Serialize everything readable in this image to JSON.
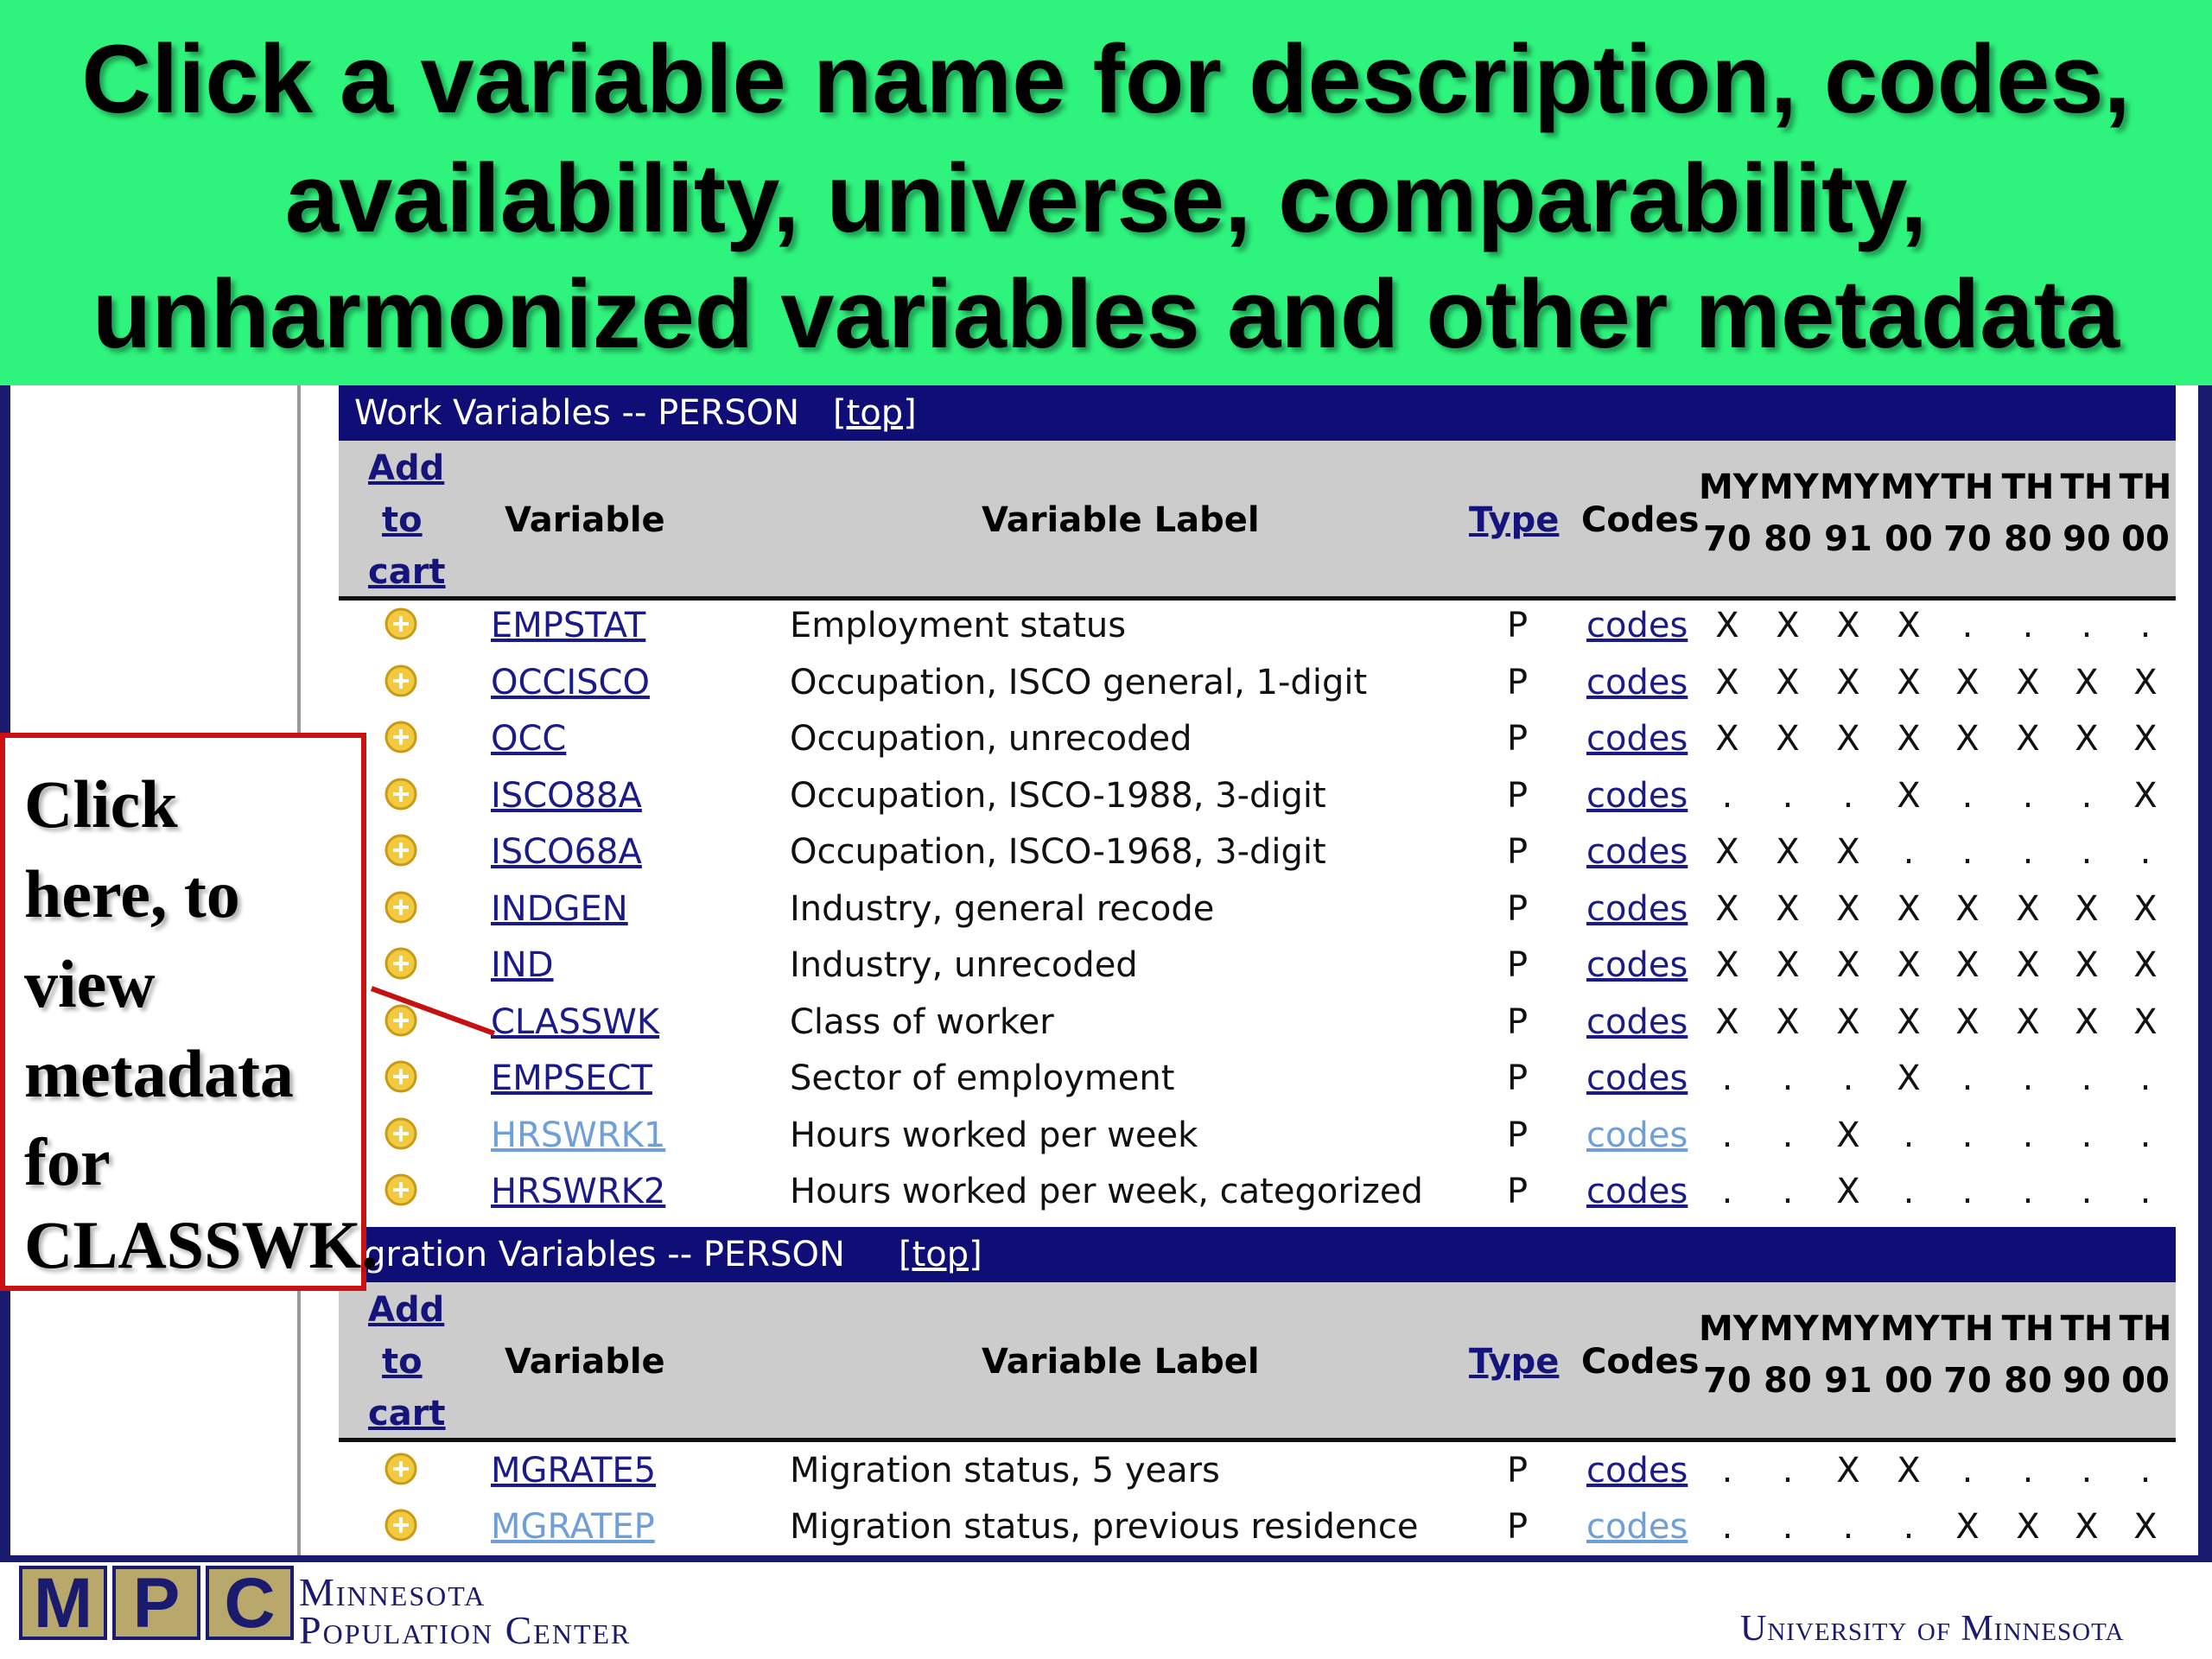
{
  "banner": {
    "lines": [
      "Click a variable name for description, codes,",
      "availability, universe, comparability,",
      "unharmonized variables and other metadata"
    ]
  },
  "columns": {
    "add_lines": [
      "Add",
      "to",
      "cart"
    ],
    "variable": "Variable",
    "label": "Variable Label",
    "type": "Type",
    "codes": "Codes",
    "sample_top": [
      "MY",
      "MY",
      "MY",
      "MY",
      "TH",
      "TH",
      "TH",
      "TH"
    ],
    "sample_bottom": [
      "70",
      "80",
      "91",
      "00",
      "70",
      "80",
      "90",
      "00"
    ]
  },
  "sections": [
    {
      "title": "Work Variables -- PERSON",
      "top_link": "[top]",
      "rows": [
        {
          "name": "EMPSTAT",
          "label": "Employment status",
          "type": "P",
          "codes": "codes",
          "marks": [
            "X",
            "X",
            "X",
            "X",
            ".",
            ".",
            ".",
            "."
          ]
        },
        {
          "name": "OCCISCO",
          "label": "Occupation, ISCO general, 1-digit",
          "type": "P",
          "codes": "codes",
          "marks": [
            "X",
            "X",
            "X",
            "X",
            "X",
            "X",
            "X",
            "X"
          ]
        },
        {
          "name": "OCC",
          "label": "Occupation, unrecoded",
          "type": "P",
          "codes": "codes",
          "marks": [
            "X",
            "X",
            "X",
            "X",
            "X",
            "X",
            "X",
            "X"
          ]
        },
        {
          "name": "ISCO88A",
          "label": "Occupation, ISCO-1988, 3-digit",
          "type": "P",
          "codes": "codes",
          "marks": [
            ".",
            ".",
            ".",
            "X",
            ".",
            ".",
            ".",
            "X"
          ]
        },
        {
          "name": "ISCO68A",
          "label": "Occupation, ISCO-1968, 3-digit",
          "type": "P",
          "codes": "codes",
          "marks": [
            "X",
            "X",
            "X",
            ".",
            ".",
            ".",
            ".",
            "."
          ]
        },
        {
          "name": "INDGEN",
          "label": "Industry, general recode",
          "type": "P",
          "codes": "codes",
          "marks": [
            "X",
            "X",
            "X",
            "X",
            "X",
            "X",
            "X",
            "X"
          ]
        },
        {
          "name": "IND",
          "label": "Industry, unrecoded",
          "type": "P",
          "codes": "codes",
          "marks": [
            "X",
            "X",
            "X",
            "X",
            "X",
            "X",
            "X",
            "X"
          ]
        },
        {
          "name": "CLASSWK",
          "label": "Class of worker",
          "type": "P",
          "codes": "codes",
          "marks": [
            "X",
            "X",
            "X",
            "X",
            "X",
            "X",
            "X",
            "X"
          ]
        },
        {
          "name": "EMPSECT",
          "label": "Sector of employment",
          "type": "P",
          "codes": "codes",
          "marks": [
            ".",
            ".",
            ".",
            "X",
            ".",
            ".",
            ".",
            "."
          ]
        },
        {
          "name": "HRSWRK1",
          "label": "Hours worked per week",
          "type": "P",
          "codes": "codes",
          "marks": [
            ".",
            ".",
            "X",
            ".",
            ".",
            ".",
            ".",
            "."
          ],
          "visited": true
        },
        {
          "name": "HRSWRK2",
          "label": "Hours worked per week, categorized",
          "type": "P",
          "codes": "codes",
          "marks": [
            ".",
            ".",
            "X",
            ".",
            ".",
            ".",
            ".",
            "."
          ]
        }
      ]
    },
    {
      "title": "igration Variables -- PERSON",
      "top_link": "[top]",
      "rows": [
        {
          "name": "MGRATE5",
          "label": "Migration status, 5 years",
          "type": "P",
          "codes": "codes",
          "marks": [
            ".",
            ".",
            "X",
            "X",
            ".",
            ".",
            ".",
            "."
          ]
        },
        {
          "name": "MGRATEP",
          "label": "Migration status, previous residence",
          "type": "P",
          "codes": "codes",
          "marks": [
            ".",
            ".",
            ".",
            ".",
            "X",
            "X",
            "X",
            "X"
          ],
          "visited": true
        }
      ]
    }
  ],
  "callout": {
    "lines": [
      "Click",
      "here,  to",
      "view",
      "metadata",
      "for",
      "CLASSWK."
    ]
  },
  "footer": {
    "logo_letters": [
      "M",
      "P",
      "C"
    ],
    "org_line1": "Minnesota",
    "org_line2": "Population Center",
    "university": "University of Minnesota"
  },
  "colors": {
    "banner": "#2ef47e",
    "section_header": "#0e0e76",
    "column_header": "#cccccc",
    "link": "#1a1a88",
    "visited_link": "#6f9fd8",
    "callout_border": "#cc1111",
    "logo_gold": "#b8a86c"
  },
  "icons": {
    "add_to_cart": "plus-circle-icon"
  }
}
